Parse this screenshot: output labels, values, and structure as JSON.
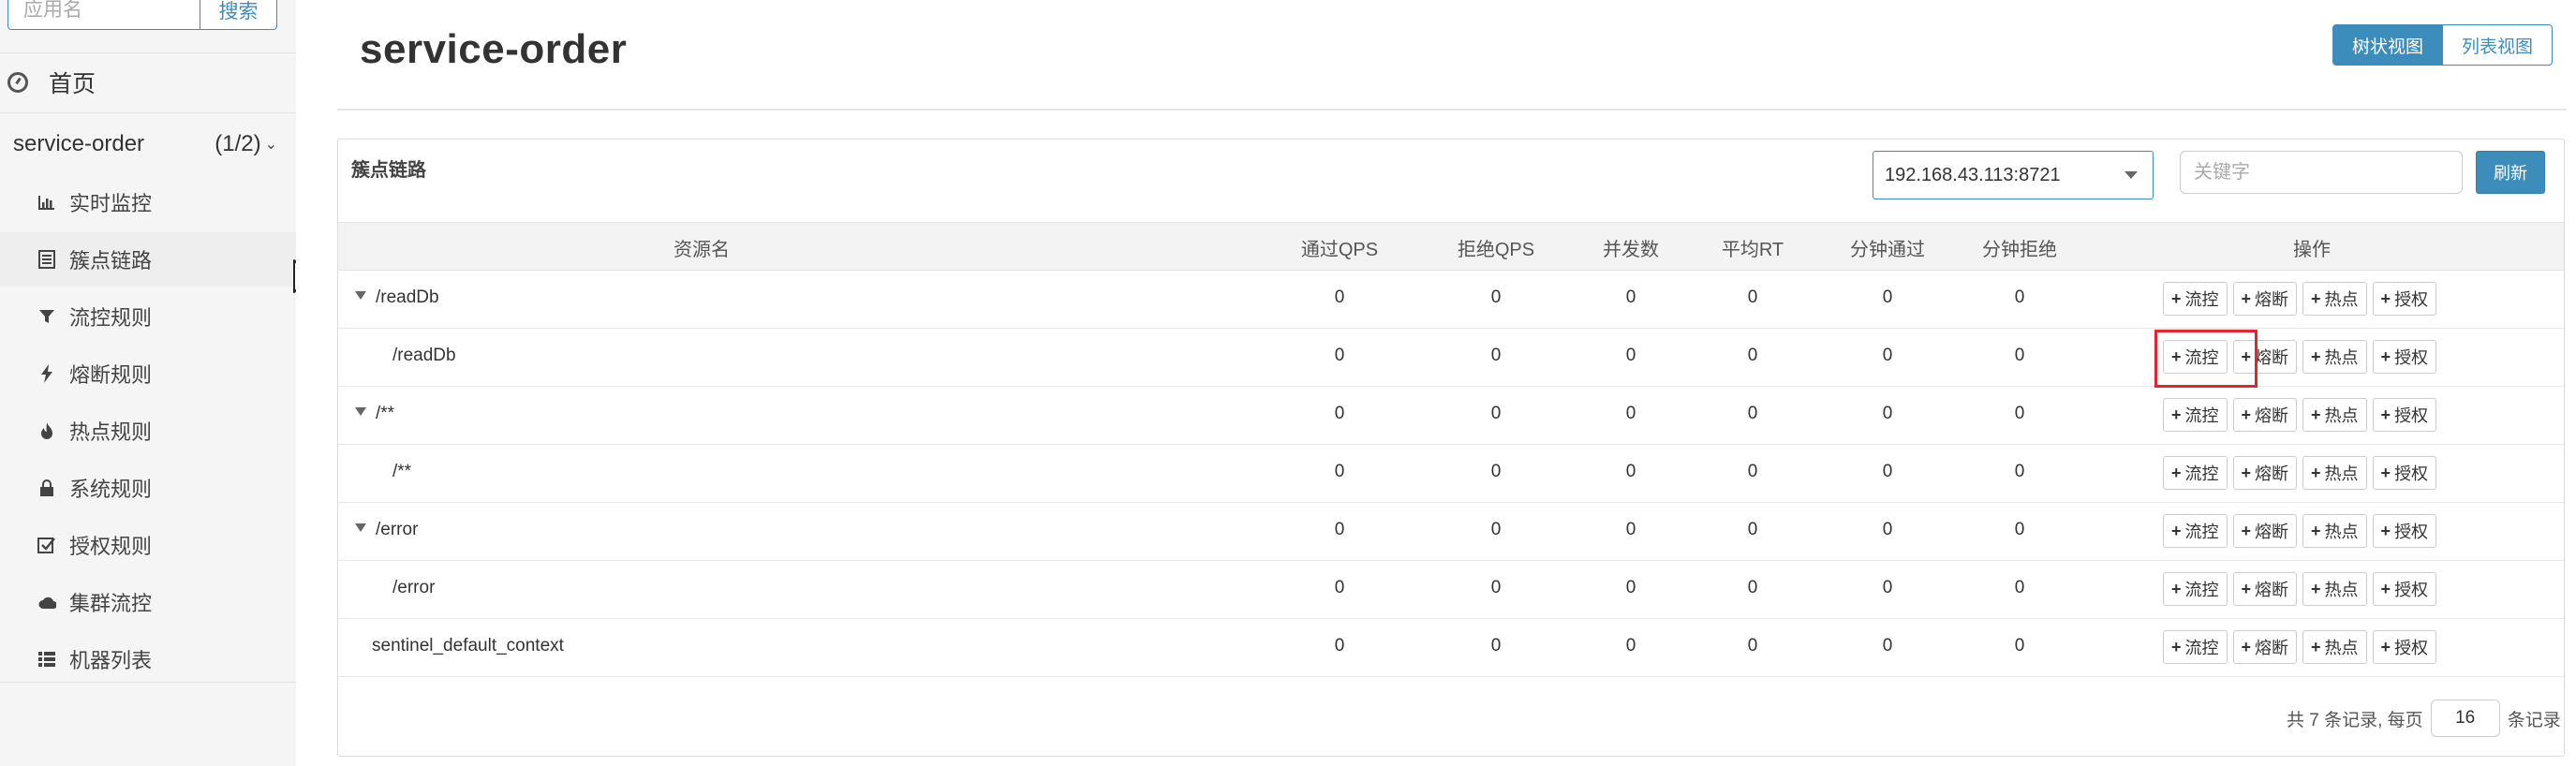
{
  "search": {
    "placeholder": "应用名",
    "button": "搜索"
  },
  "sidebar": {
    "home": "首页",
    "app_name": "service-order",
    "app_count": "(1/2)",
    "items": [
      {
        "label": "实时监控",
        "icon": "bar-chart-icon"
      },
      {
        "label": "簇点链路",
        "icon": "list-icon"
      },
      {
        "label": "流控规则",
        "icon": "filter-icon"
      },
      {
        "label": "熔断规则",
        "icon": "flash-icon"
      },
      {
        "label": "热点规则",
        "icon": "fire-icon"
      },
      {
        "label": "系统规则",
        "icon": "lock-icon"
      },
      {
        "label": "授权规则",
        "icon": "check-icon"
      },
      {
        "label": "集群流控",
        "icon": "cloud-icon"
      },
      {
        "label": "机器列表",
        "icon": "th-list-icon"
      }
    ]
  },
  "header": {
    "title": "service-order",
    "tree_view": "树状视图",
    "list_view": "列表视图"
  },
  "panel": {
    "title": "簇点链路",
    "machine": "192.168.43.113:8721",
    "keyword_placeholder": "关键字",
    "refresh": "刷新"
  },
  "table": {
    "headers": [
      "资源名",
      "通过QPS",
      "拒绝QPS",
      "并发数",
      "平均RT",
      "分钟通过",
      "分钟拒绝",
      "操作"
    ],
    "op_labels": {
      "flow": "流控",
      "degrade": "熔断",
      "hot": "热点",
      "auth": "授权"
    },
    "rows": [
      {
        "name": "/readDb",
        "level": 0,
        "expandable": true,
        "values": [
          "0",
          "0",
          "0",
          "0",
          "0",
          "0"
        ]
      },
      {
        "name": "/readDb",
        "level": 1,
        "expandable": false,
        "values": [
          "0",
          "0",
          "0",
          "0",
          "0",
          "0"
        ]
      },
      {
        "name": "/**",
        "level": 0,
        "expandable": true,
        "values": [
          "0",
          "0",
          "0",
          "0",
          "0",
          "0"
        ]
      },
      {
        "name": "/**",
        "level": 1,
        "expandable": false,
        "values": [
          "0",
          "0",
          "0",
          "0",
          "0",
          "0"
        ]
      },
      {
        "name": "/error",
        "level": 0,
        "expandable": true,
        "values": [
          "0",
          "0",
          "0",
          "0",
          "0",
          "0"
        ]
      },
      {
        "name": "/error",
        "level": 1,
        "expandable": false,
        "values": [
          "0",
          "0",
          "0",
          "0",
          "0",
          "0"
        ]
      },
      {
        "name": "sentinel_default_context",
        "level": 0,
        "expandable": false,
        "values": [
          "0",
          "0",
          "0",
          "0",
          "0",
          "0"
        ]
      }
    ]
  },
  "pager": {
    "prefix": "共 7 条记录, 每页",
    "page_size": "16",
    "suffix": "条记录"
  },
  "colors": {
    "accent": "#3c8dbc",
    "highlight": "#e3262b"
  }
}
